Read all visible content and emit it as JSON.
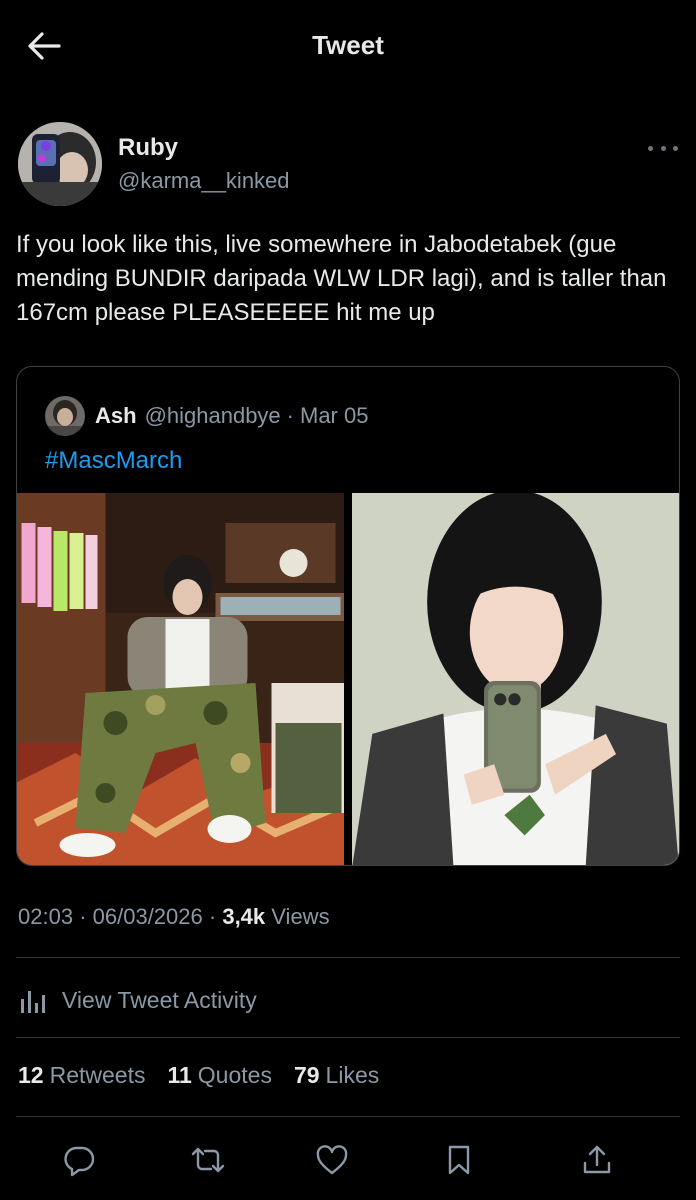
{
  "header": {
    "title": "Tweet",
    "back_icon": "arrow-left-icon"
  },
  "tweet": {
    "author_name": "Ruby",
    "author_handle": "@karma__kinked",
    "text": "If you look like this, live somewhere in Jabodetabek (gue mending BUNDIR daripada WLW LDR lagi), and is taller than 167cm please PLEASEEEEE hit me up",
    "more_icon": "more-horizontal-icon"
  },
  "quoted_tweet": {
    "author_name": "Ash",
    "author_handle": "@highandbye",
    "separator": "·",
    "date": "Mar 05",
    "hashtag": "#MascMarch",
    "media_count": 2
  },
  "meta": {
    "time": "02:03",
    "sep1": "·",
    "date": "06/03/2026",
    "sep2": "·",
    "views_count": "3,4k",
    "views_label": "Views"
  },
  "activity": {
    "label": "View Tweet Activity",
    "icon": "bar-chart-icon"
  },
  "stats": {
    "retweets_count": "12",
    "retweets_label": "Retweets",
    "quotes_count": "11",
    "quotes_label": "Quotes",
    "likes_count": "79",
    "likes_label": "Likes"
  },
  "actions": [
    "reply-icon",
    "retweet-icon",
    "like-icon",
    "bookmark-icon",
    "share-icon"
  ],
  "colors": {
    "background": "#000000",
    "text_primary": "#e7e9ea",
    "text_secondary": "#8b98a5",
    "accent_link": "#1d9bf0",
    "border": "#2f3336"
  }
}
